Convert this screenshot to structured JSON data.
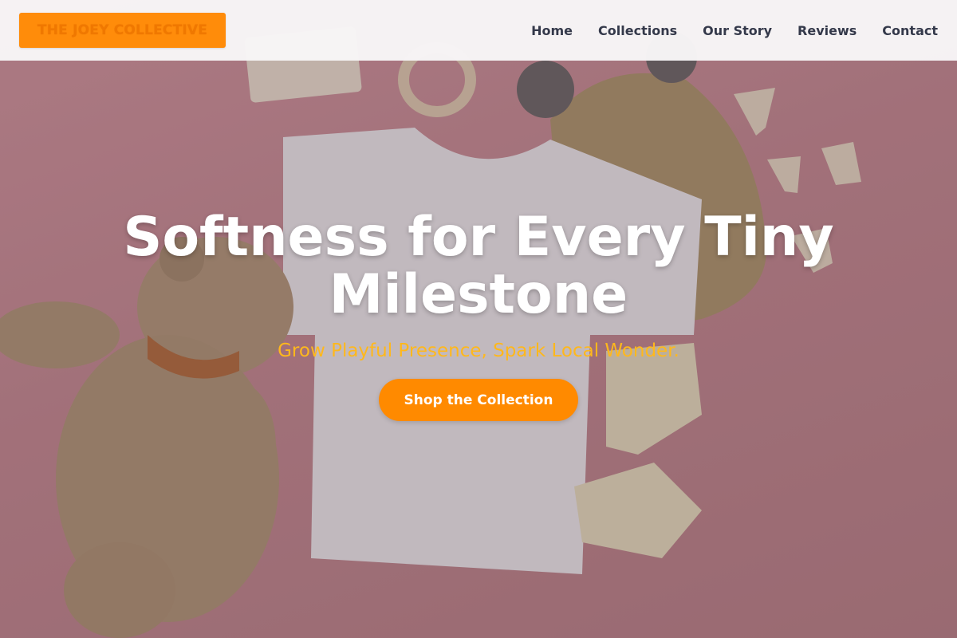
{
  "brand": {
    "logo_text": "THE JOEY COLLECTIVE"
  },
  "nav": {
    "items": [
      {
        "label": "Home"
      },
      {
        "label": "Collections"
      },
      {
        "label": "Our Story"
      },
      {
        "label": "Reviews"
      },
      {
        "label": "Contact"
      }
    ]
  },
  "hero": {
    "title": "Softness for Every Tiny Milestone",
    "subtitle": "Grow Playful Presence, Spark Local Wonder.",
    "cta_label": "Shop the Collection",
    "background_image": "baby clothes flat lay on pink background"
  },
  "colors": {
    "accent": "#ff8a00",
    "subtitle": "#ffb81c",
    "nav_text": "#34394a",
    "nav_bg": "#f8f6f7"
  }
}
